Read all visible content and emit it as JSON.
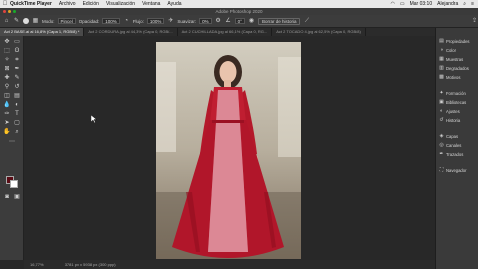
{
  "menubar": {
    "app": "QuickTime Player",
    "items": [
      "Archivo",
      "Edición",
      "Visualización",
      "Ventana",
      "Ayuda"
    ],
    "clock": "Mar 03:10",
    "user": "Alejandra"
  },
  "window": {
    "title": "Adobe Photoshop 2020"
  },
  "options_bar": {
    "modo_label": "Modo:",
    "modo_value": "Pincel",
    "opacidad_label": "Opacidad:",
    "opacidad_value": "100%",
    "flujo_label": "Flujo:",
    "flujo_value": "100%",
    "suavizar_label": "Suavizar:",
    "suavizar_value": "0%",
    "angle_value": "0°",
    "erase_history_label": "Borrar de historia"
  },
  "tabs": [
    {
      "label": "Act 2 BASE.ai al 16,8% (Capa 1, RGB/8) *",
      "active": true
    },
    {
      "label": "Act 2 CORDURA.jpg al 44,3% (Capa 0, RGB/...",
      "active": false
    },
    {
      "label": "Act 2 CUCHILLADA.jpg al 66,1% (Capa 0, RG...",
      "active": false
    },
    {
      "label": "Act 2 TOCADO 4.jpg al 62,5% (Capa 0, RGB/8)",
      "active": false
    }
  ],
  "status": {
    "zoom": "16,77%",
    "doc_size": "3781 px x 5938 px (300 ppp)"
  },
  "panels": {
    "group1": [
      "Propiedades",
      "Color",
      "Muestras",
      "Degradados",
      "Motivos"
    ],
    "group2": [
      "Formación",
      "Bibliotecas",
      "Ajustes",
      "Historia"
    ],
    "group3": [
      "Capas",
      "Canales",
      "Trazados"
    ],
    "group4": [
      "Navegador"
    ]
  },
  "colors": {
    "foreground": "#5a0d16",
    "background": "#ffffff",
    "accent_dress": "#b41a2b"
  }
}
